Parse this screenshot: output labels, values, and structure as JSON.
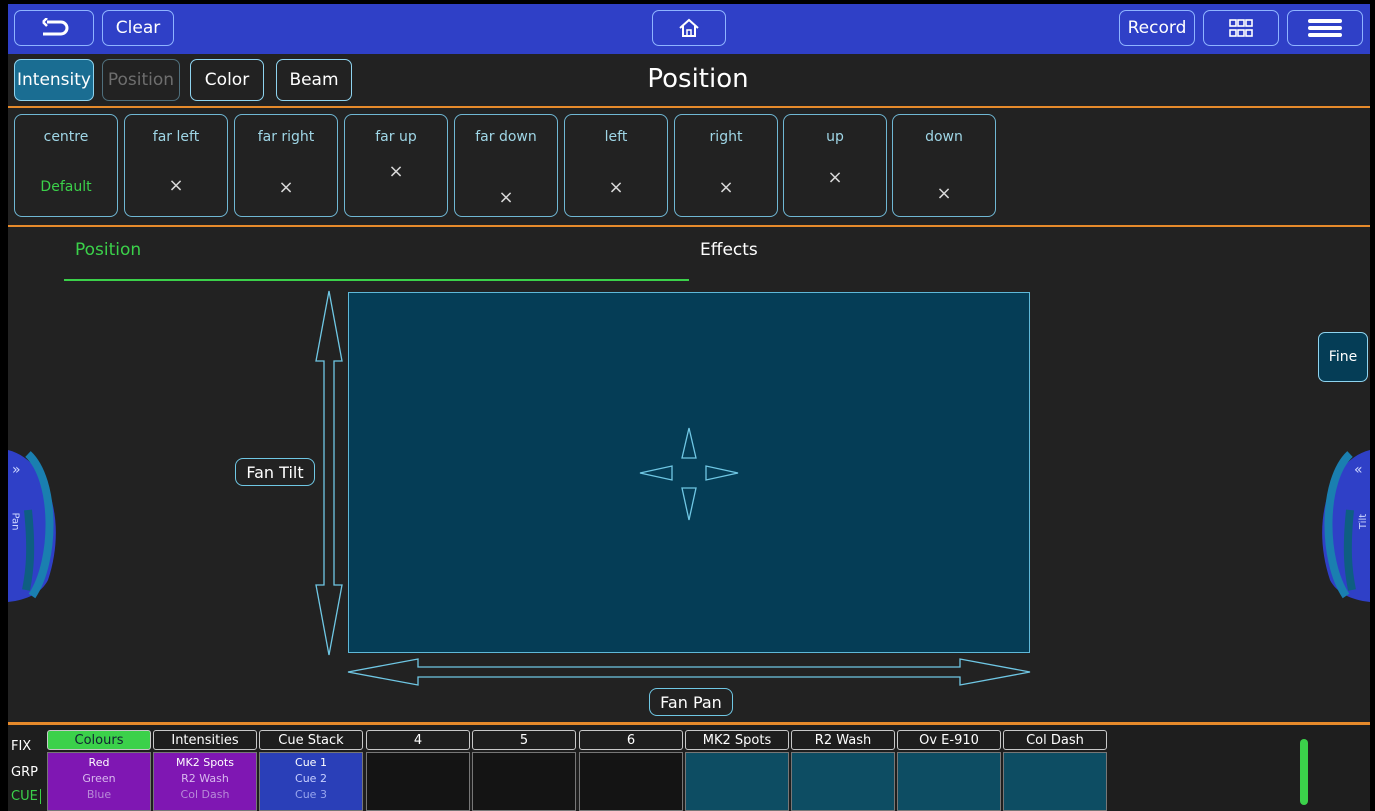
{
  "topbar": {
    "back_label": "",
    "clear_label": "Clear",
    "record_label": "Record"
  },
  "tabs": [
    {
      "label": "Intensity",
      "state": "active"
    },
    {
      "label": "Position",
      "state": "disabled"
    },
    {
      "label": "Color",
      "state": "normal"
    },
    {
      "label": "Beam",
      "state": "normal"
    }
  ],
  "page_title": "Position",
  "presets": [
    {
      "name": "centre",
      "value": "Default"
    },
    {
      "name": "far left",
      "value": "×"
    },
    {
      "name": "far right",
      "value": "×"
    },
    {
      "name": "far up",
      "value": "×"
    },
    {
      "name": "far down",
      "value": "×"
    },
    {
      "name": "left",
      "value": "×"
    },
    {
      "name": "right",
      "value": "×"
    },
    {
      "name": "up",
      "value": "×"
    },
    {
      "name": "down",
      "value": "×"
    }
  ],
  "subtabs": {
    "position": "Position",
    "effects": "Effects"
  },
  "fan_tilt_label": "Fan Tilt",
  "fan_pan_label": "Fan Pan",
  "fine_label": "Fine",
  "pan_wheel_label": "Pan",
  "tilt_wheel_label": "Tilt",
  "bottom": {
    "row_labels": [
      "FIX",
      "GRP",
      "CUE"
    ],
    "columns": [
      {
        "header": "Colours",
        "lines": [
          "Red",
          "Green",
          "Blue"
        ]
      },
      {
        "header": "Intensities",
        "lines": [
          "MK2 Spots",
          "R2 Wash",
          "Col Dash"
        ]
      },
      {
        "header": "Cue Stack",
        "lines": [
          "Cue 1",
          "Cue 2",
          "Cue 3"
        ]
      },
      {
        "header": "4",
        "lines": []
      },
      {
        "header": "5",
        "lines": []
      },
      {
        "header": "6",
        "lines": []
      },
      {
        "header": "MK2 Spots",
        "lines": []
      },
      {
        "header": "R2 Wash",
        "lines": []
      },
      {
        "header": "Ov E-910",
        "lines": []
      },
      {
        "header": "Col Dash",
        "lines": []
      }
    ]
  },
  "colors": {
    "topbar": "#2f40c7",
    "accent_green": "#3bd14a",
    "accent_orange": "#e68a2b",
    "pad_fill": "#053d56",
    "colours_purple": "#7f17b3",
    "cuestack_blue": "#2a3fb8",
    "playback_teal": "#0d4d63"
  }
}
